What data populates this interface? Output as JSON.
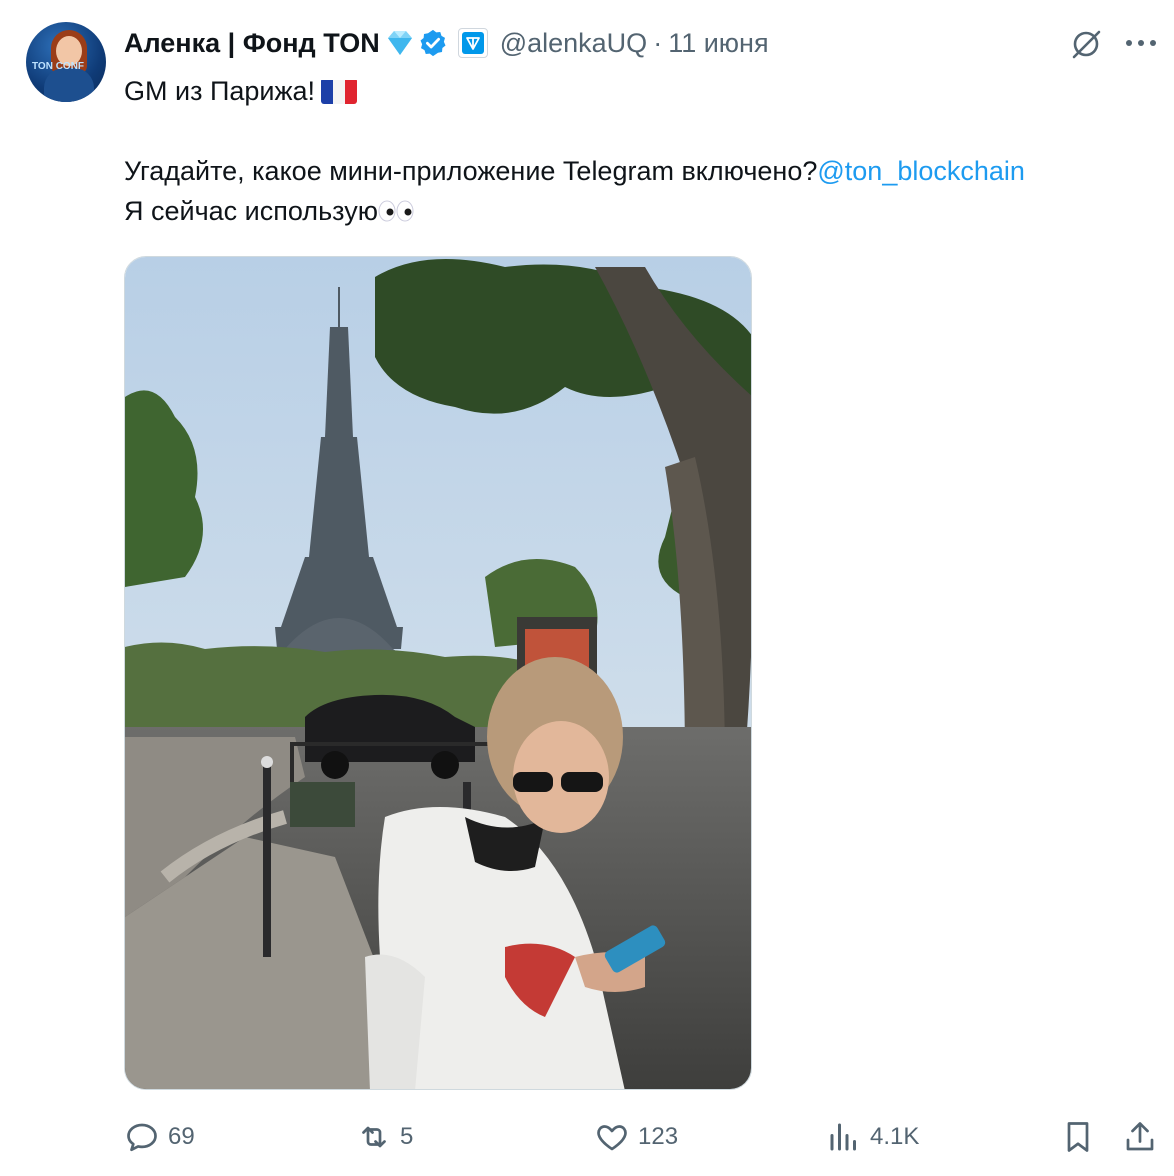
{
  "tweet": {
    "author_name": "Аленка | Фонд TON",
    "handle": "@alenkaUQ",
    "separator": "·",
    "date": "11 июня",
    "text_line1": "GM из Парижа!",
    "text_line2_prefix": "Угадайте, какое мини-приложение Telegram включено?",
    "mention": "@ton_blockchain",
    "text_line3": "Я сейчас использую",
    "avatar_badge_text": "TON CONF"
  },
  "icons": {
    "diamond": "diamond-emoji-icon",
    "verified": "verified-badge-icon",
    "affiliate": "ton-affiliate-badge-icon",
    "grok": "grok-icon",
    "more": "more-options-icon",
    "flag": "france-flag-emoji",
    "eyes": "eyes-emoji",
    "reply": "reply-icon",
    "retweet": "retweet-icon",
    "like": "like-icon",
    "views": "views-icon",
    "bookmark": "bookmark-icon",
    "share": "share-icon"
  },
  "stats": {
    "replies": "69",
    "reposts": "5",
    "likes": "123",
    "views": "4.1K"
  },
  "colors": {
    "link": "#1d9bf0",
    "muted": "#536471",
    "verified": "#1d9bf0"
  }
}
